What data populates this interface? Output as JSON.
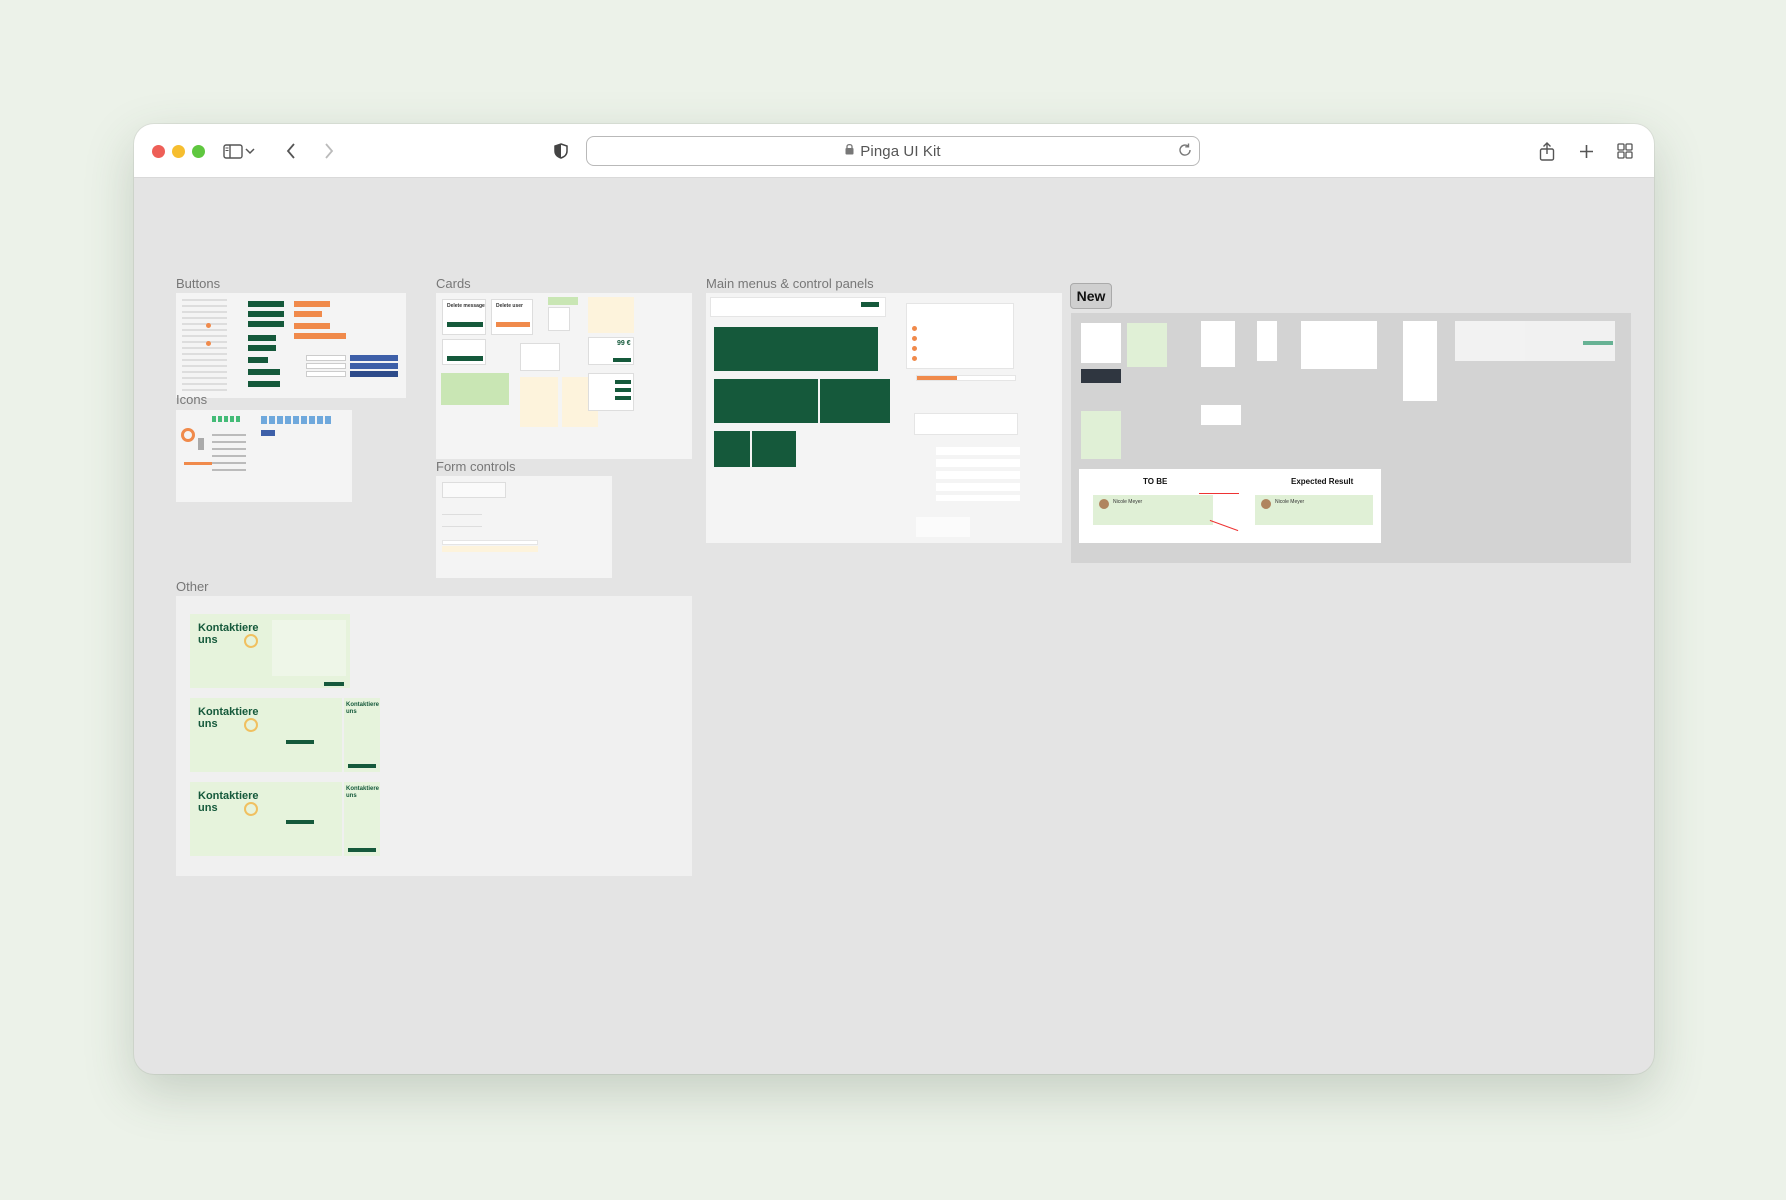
{
  "browser": {
    "url_text": "Pinga UI Kit",
    "traffic_lights": {
      "close": "#ee5f57",
      "minimize": "#f6be2f",
      "zoom": "#5fc73f"
    },
    "icons": [
      "sidebar-icon",
      "chevron-down-icon",
      "back-icon",
      "forward-icon",
      "shield-icon",
      "lock-icon",
      "reload-icon",
      "share-icon",
      "new-tab-icon",
      "tab-overview-icon"
    ]
  },
  "canvas": {
    "sections": {
      "buttons": "Buttons",
      "icons": "Icons",
      "cards": "Cards",
      "form_controls": "Form controls",
      "menus": "Main menus & control panels",
      "new": "New",
      "other": "Other"
    },
    "cards_preview": {
      "delete_message": "Delete message",
      "delete_user": "Delete user",
      "price": "99 €"
    },
    "new_preview": {
      "to_be": "TO BE",
      "expected": "Expected Result",
      "person": "Nicole Meyer"
    },
    "other_preview": {
      "contact_title": "Kontaktiere uns"
    },
    "colors": {
      "brand_green": "#15593b",
      "orange": "#f08a4b",
      "blue": "#3d5fa8",
      "light_green": "#dff0d2",
      "cream": "#fdf3dc"
    }
  }
}
